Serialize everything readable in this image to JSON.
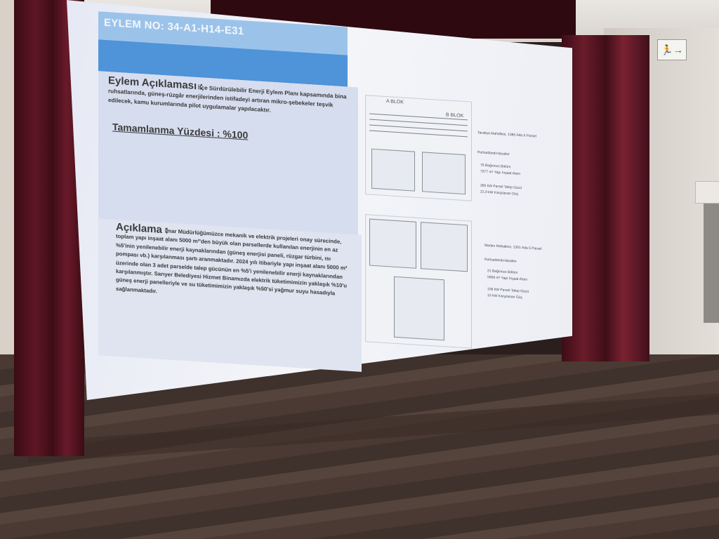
{
  "slide": {
    "title": "EYLEM NO: 34-A1-H14-E31",
    "description_heading": "Eylem Açıklaması :",
    "description_body": "İlçe Sürdürülebilir Enerji Eylem Planı kapsamında bina ruhsatlarında, güneş-rüzgâr enerjilerinden istifadeyi artıran mikro-şebekeler teşvik edilecek, kamu kurumlarında pilot uygulamalar yapılacaktır.",
    "completion_label": "Tamamlanma Yüzdesi :  %100",
    "note_heading": "Açıklama  :",
    "note_body": "İmar Müdürlüğümüzce mekanik ve elektrik projeleri onay sürecinde, toplam yapı inşaat alanı 5000 m²'den büyük olan parsellerde kullanılan enerjinin en az %5'inin yenilenebilir enerji kaynaklarından (güneş enerjisi paneli, rüzgar türbini, ısı pompası vb.) karşılanması şartı aranmaktadır. 2024 yılı itibariyle yapı inşaat alanı 5000 m² üzerinde olan 3 adet parselde talep gücünün en %5'i yenilenebilir enerji kaynaklarından karşılanmıştır. Sarıyer Belediyesi Hizmet Binamızda elektrik tüketimimizin yaklaşık %10'u güneş enerji panelleriyle ve su tüketimimizin yaklaşık %50'si yağmur suyu hasadıyla sağlanmaktadır.",
    "plan_top": {
      "label_a": "A BLOK",
      "label_b": "B BLOK"
    },
    "side_top_title": "Tarabya Mahallesi, 1385 Ada 6 Parsel",
    "side_top_sub": "Ruhsatlandırılacaktır",
    "side_top_items": [
      "76 Bağımsız Bölüm",
      "7577 m² Yapı İnşaat Alanı",
      "280 kW Parsel Talep Gücü",
      "21,9 kW Karşılanan Güç"
    ],
    "side_bottom_title": "Maden Mahallesi, 1391 Ada 5 Parsel",
    "side_bottom_sub": "Ruhsatlandırılacaktır",
    "side_bottom_items": [
      "21 Bağımsız Bölüm",
      "5968 m² Yapı İnşaat Alanı",
      "108 kW Parsel Talep Gücü",
      "10 kW Karşılanan Güç"
    ]
  },
  "room": {
    "exit_sign_icon": "exit-running-man-icon"
  },
  "colors": {
    "title_bar": "#4f93d9",
    "title_bar_light": "#9bc3ea",
    "curtain": "#5e1624"
  }
}
